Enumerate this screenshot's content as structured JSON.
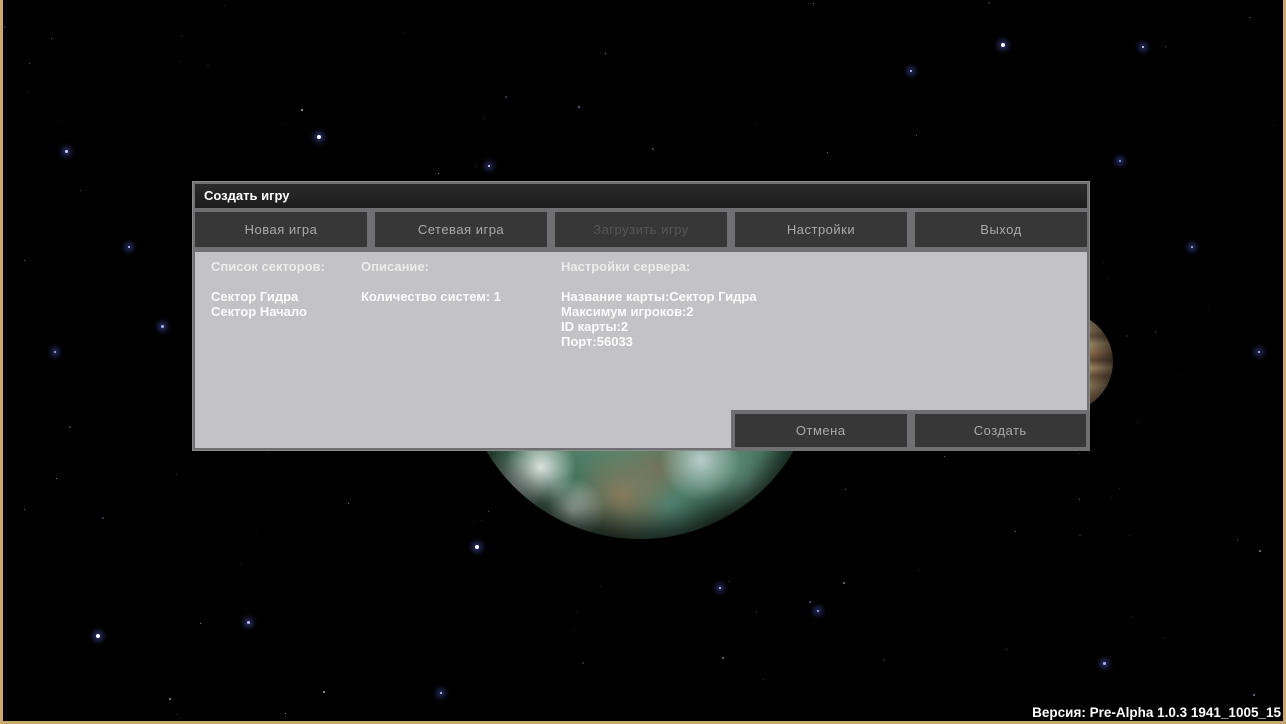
{
  "window": {
    "title": "Создать игру"
  },
  "menu_buttons": [
    {
      "id": "new-game",
      "label": "Новая игра",
      "enabled": true
    },
    {
      "id": "network-game",
      "label": "Сетевая игра",
      "enabled": true
    },
    {
      "id": "load-game",
      "label": "Загрузить игру",
      "enabled": false
    },
    {
      "id": "settings",
      "label": "Настройки",
      "enabled": true
    },
    {
      "id": "exit",
      "label": "Выход",
      "enabled": true
    }
  ],
  "panel": {
    "sectors": {
      "header": "Список секторов:",
      "items": [
        "Сектор Гидра",
        "Сектор Начало"
      ]
    },
    "description": {
      "header": "Описание:",
      "lines": [
        "Количество систем: 1"
      ]
    },
    "server": {
      "header": "Настройки сервера:",
      "lines": [
        "Название карты:Сектор Гидра",
        "Максимум игроков:2",
        "ID карты:2",
        "Порт:56033"
      ]
    }
  },
  "action_buttons": [
    {
      "id": "cancel",
      "label": "Отмена"
    },
    {
      "id": "create",
      "label": "Создать"
    }
  ],
  "status": {
    "version": "Версия: Pre-Alpha 1.0.3 1941_1005_15"
  },
  "colors": {
    "window_border": "#c8a870",
    "dialog_frame": "#707073",
    "titlebar": "#212121",
    "panel": "#c3c3c5",
    "button": "#373737",
    "button_text": "#a9a9a9",
    "button_text_disabled": "#565656",
    "panel_text": "#fbfbfb",
    "space_background": "#000000"
  }
}
